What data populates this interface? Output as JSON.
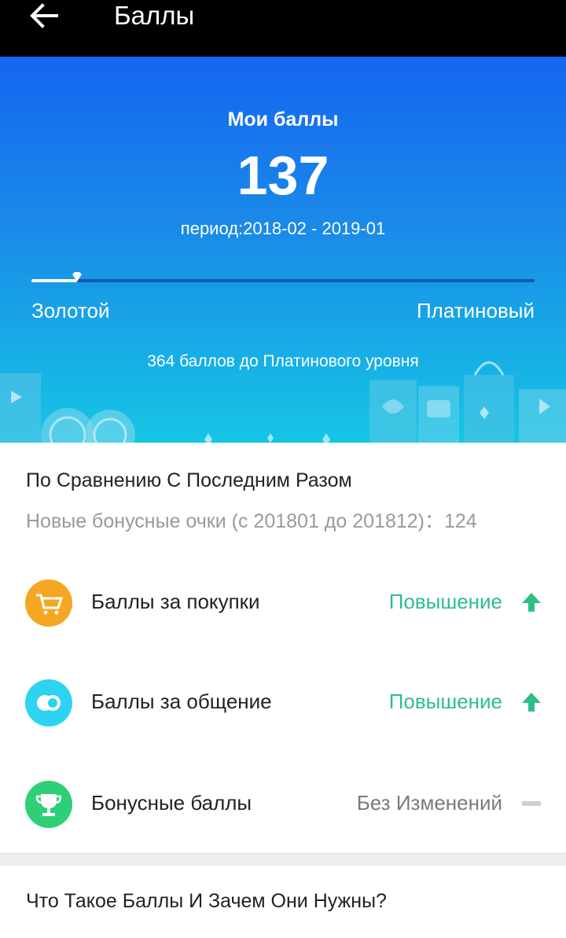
{
  "topbar": {
    "title": "Баллы",
    "back_icon": "arrow-left-icon"
  },
  "hero": {
    "label": "Мои баллы",
    "points": "137",
    "period": "период:2018-02 - 2019-01",
    "progress_fraction": 0.09,
    "level_current": "Золотой",
    "level_next": "Платиновый",
    "remaining": "364 баллов до Платинового уровня"
  },
  "comparison": {
    "title": "По Сравнению С Последним Разом",
    "summary": "Новые бонусные очки (с 201801 до 201812)：124",
    "items": [
      {
        "label": "Баллы за покупки",
        "status": "Повышение",
        "icon": "cart-icon",
        "color": "#f5a623",
        "trend": "up"
      },
      {
        "label": "Баллы за общение",
        "status": "Повышение",
        "icon": "chat-circles-icon",
        "color": "#2ed3f2",
        "trend": "up"
      },
      {
        "label": "Бонусные баллы",
        "status": "Без Изменений",
        "icon": "trophy-icon",
        "color": "#2ecf77",
        "trend": "none"
      }
    ]
  },
  "faq": {
    "label": "Что Такое Баллы И Зачем Они Нужны?"
  },
  "colors": {
    "up": "#2dbf86",
    "none": "#7a7a7a",
    "header_bg": "#000000",
    "hero_top": "#1565f0",
    "hero_bottom": "#15c6e4"
  }
}
